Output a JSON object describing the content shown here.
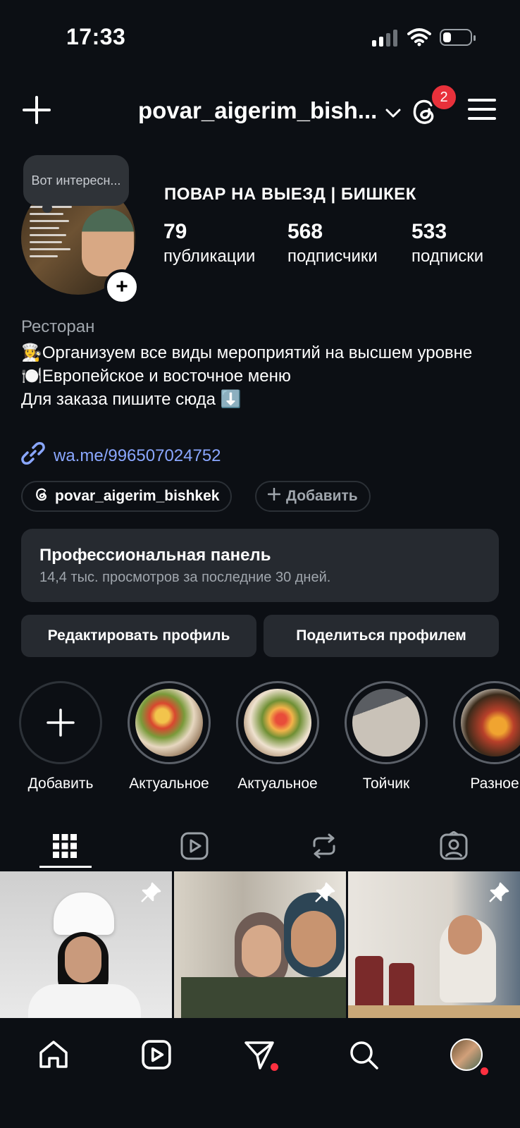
{
  "status_bar": {
    "time": "17:33",
    "signal_bars": 4,
    "signal_active_bars": 2,
    "battery_level": 0.3
  },
  "header": {
    "username": "povar_aigerim_bish...",
    "notification_count": "2",
    "icons": [
      "plus-icon",
      "chevron-down-icon",
      "threads-icon",
      "menu-icon"
    ]
  },
  "profile": {
    "note": "Вот интересн...",
    "name": "ПОВАР НА ВЫЕЗД | БИШКЕК",
    "stats": [
      {
        "value": "79",
        "label": "публикации"
      },
      {
        "value": "568",
        "label": "подписчики"
      },
      {
        "value": "533",
        "label": "подписки"
      }
    ],
    "category": "Ресторан",
    "bio": [
      "👩‍🍳Организуем все виды мероприятий на высшем уровне",
      "🍽️Европейское и восточное меню",
      "Для заказа пишите сюда ⬇️"
    ],
    "link": "wa.me/996507024752"
  },
  "chips": {
    "threads": "povar_aigerim_bishkek",
    "add": "Добавить"
  },
  "pro_panel": {
    "title": "Профессиональная панель",
    "subtitle": "14,4 тыс. просмотров за последние 30 дней."
  },
  "actions": {
    "edit": "Редактировать профиль",
    "share": "Поделиться профилем"
  },
  "highlights": [
    {
      "label": "Добавить"
    },
    {
      "label": "Актуальное"
    },
    {
      "label": "Актуальное"
    },
    {
      "label": "Тойчик"
    },
    {
      "label": "Разное"
    }
  ],
  "tabs": [
    "grid-icon",
    "reels-icon",
    "reposts-icon",
    "tagged-icon"
  ],
  "colors": {
    "background": "#0c0f14",
    "panel": "#262a30",
    "link": "#8aa7ff",
    "badge": "#e8313b"
  }
}
